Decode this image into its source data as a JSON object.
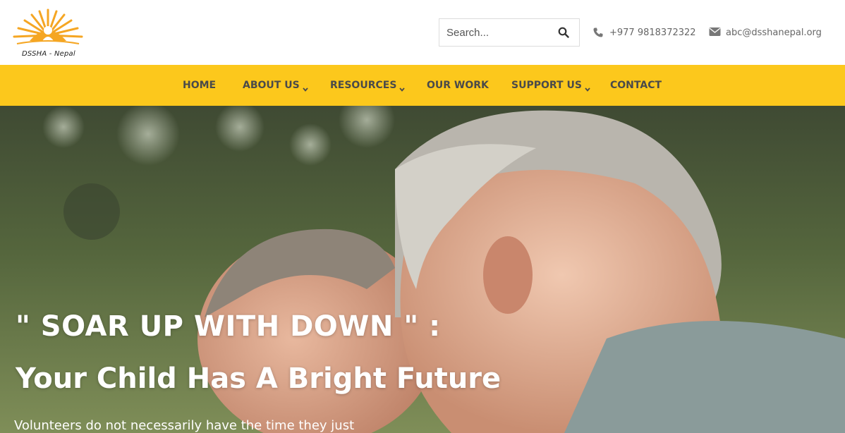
{
  "brand": {
    "logo_text": "DSSHA - Nepal",
    "accent_color": "#fcc81c",
    "sun_color": "#f5a623"
  },
  "header": {
    "search_placeholder": "Search...",
    "search_icon": "search-icon",
    "phone_icon": "phone-icon",
    "phone": "+977 9818372322",
    "email_icon": "envelope-icon",
    "email": "abc@dsshanepal.org"
  },
  "nav": {
    "items": [
      {
        "label": "HOME",
        "has_dropdown": false
      },
      {
        "label": "ABOUT US",
        "has_dropdown": true
      },
      {
        "label": "RESOURCES",
        "has_dropdown": true
      },
      {
        "label": "OUR WORK",
        "has_dropdown": false
      },
      {
        "label": "SUPPORT US",
        "has_dropdown": true
      },
      {
        "label": "CONTACT",
        "has_dropdown": false
      }
    ]
  },
  "hero": {
    "title_line1": "\" SOAR UP WITH DOWN \" :",
    "title_line2": "Your Child Has A Bright Future",
    "subtitle": "Volunteers do not necessarily have the time they just"
  }
}
